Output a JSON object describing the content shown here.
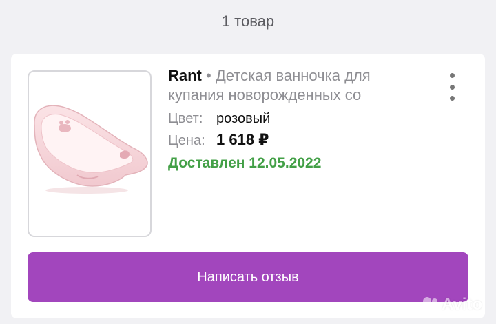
{
  "header": {
    "items_count": "1 товар"
  },
  "order": {
    "brand": "Rant",
    "separator": "•",
    "product_name": "Детская ванночка для купания новорожденных со",
    "color_label": "Цвет:",
    "color_value": "розовый",
    "price_label": "Цена:",
    "price_value": "1 618 ₽",
    "status": "Доставлен 12.05.2022",
    "review_button": "Написать отзыв",
    "menu_icon": "more-vertical-icon",
    "image_icon": "baby-bathtub-image"
  },
  "watermark": {
    "text": "Avito"
  },
  "colors": {
    "accent": "#a246bd",
    "status_green": "#43a047",
    "page_bg": "#f1f1f4"
  }
}
